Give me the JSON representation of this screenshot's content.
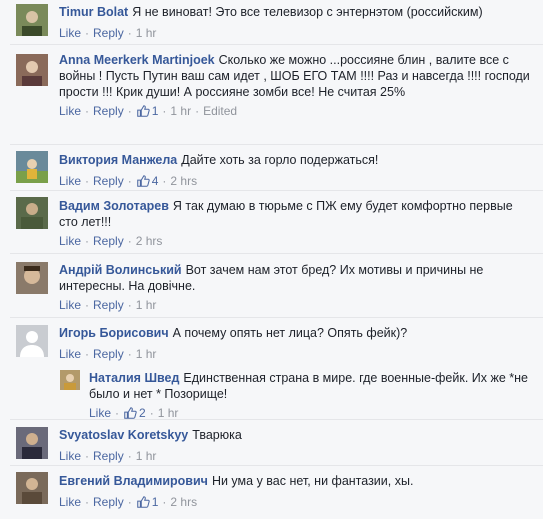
{
  "ui": {
    "like": "Like",
    "reply": "Reply",
    "dot": "·"
  },
  "comments": [
    {
      "author": "Timur Bolat",
      "text": "Я не виноват! Это все телевизор с энтернэтом (российским)",
      "likes": "",
      "time": "1 hr",
      "edited": "",
      "avatar_color": "#7a8a5a"
    },
    {
      "author": "Anna Meerkerk Martinjoek",
      "text": "Сколько же можно ...россияне блин , валите все с войны ! Пусть Путин ваш сам идет , ШОБ ЕГО ТАМ !!!! Раз и навсегда !!!! господи прости !!! Крик души! А россияне зомби все! Не считая 25%",
      "likes": "1",
      "time": "1 hr",
      "edited": "Edited",
      "avatar_color": "#8a6a5a"
    },
    {
      "author": "Виктория Манжела",
      "text": "Дайте хоть за горло подержаться!",
      "likes": "4",
      "time": "2 hrs",
      "edited": "",
      "avatar_color": "#6a8a9a"
    },
    {
      "author": "Вадим Золотарев",
      "text": "Я так думаю в тюрьме с ПЖ ему будет комфортно первые сто лет!!!",
      "likes": "",
      "time": "2 hrs",
      "edited": "",
      "avatar_color": "#5a6a4a"
    },
    {
      "author": "Андрій Волинський",
      "text": "Вот зачем нам этот бред? Их мотивы и причины не интересны. На довічне.",
      "likes": "",
      "time": "1 hr",
      "edited": "",
      "avatar_color": "#8a7a6a"
    },
    {
      "author": "Игорь Борисович",
      "text": "А почему опять нет лица? Опять фейк)?",
      "likes": "",
      "time": "1 hr",
      "edited": "",
      "avatar_color": "#c9ccd1"
    },
    {
      "author": "Наталия Швед",
      "text": "Единственная страна в мире. где военные-фейк. Их же *не было и нет * Позорище!",
      "likes": "2",
      "time": "1 hr",
      "edited": "",
      "avatar_color": "#b39a6a"
    },
    {
      "author": "Svyatoslav Koretskyy",
      "text": "Тварюка",
      "likes": "",
      "time": "1 hr",
      "edited": "",
      "avatar_color": "#6a6a7a"
    },
    {
      "author": "Евгений Владимирович",
      "text": "Ни ума у вас нет, ни фантазии, хы.",
      "likes": "1",
      "time": "2 hrs",
      "edited": "",
      "avatar_color": "#7a6a5a"
    }
  ]
}
